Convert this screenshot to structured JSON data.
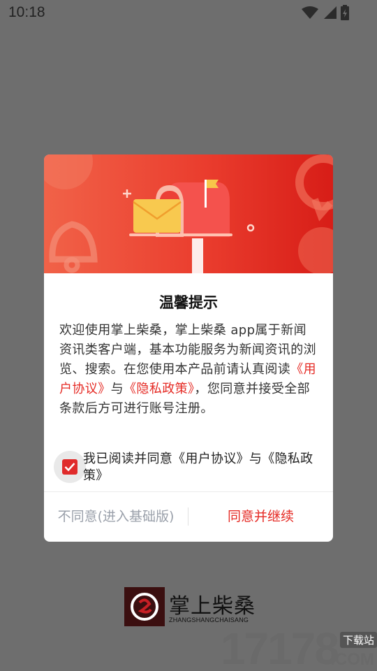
{
  "status_bar": {
    "time": "10:18",
    "icons": [
      "wifi-icon",
      "signal-icon",
      "battery-icon"
    ]
  },
  "dialog": {
    "title": "温馨提示",
    "body": {
      "part1": "欢迎使用掌上柴桑，掌上柴桑 app属于新闻资讯类客户端，基本功能服务为新闻资讯的浏览、搜索。在您使用本产品前请认真阅读",
      "link1": "《用户协议》",
      "part2": "与",
      "link2": "《隐私政策》",
      "part3": "，您同意并接受全部条款后方可进行账号注册。"
    },
    "consent": {
      "checked": true,
      "label": "我已阅读并同意《用户协议》与《隐私政策》"
    },
    "buttons": {
      "disagree": "不同意(进入基础版)",
      "agree": "同意并继续"
    }
  },
  "brand": {
    "name": "掌上柴桑",
    "subtitle": "ZHANGSHANGCHAISANG"
  },
  "watermark": {
    "number": "17178",
    "tag": "下载站",
    "domain": ".COM"
  },
  "colors": {
    "accent": "#e52a24",
    "overlay": "#6e6e6e"
  }
}
